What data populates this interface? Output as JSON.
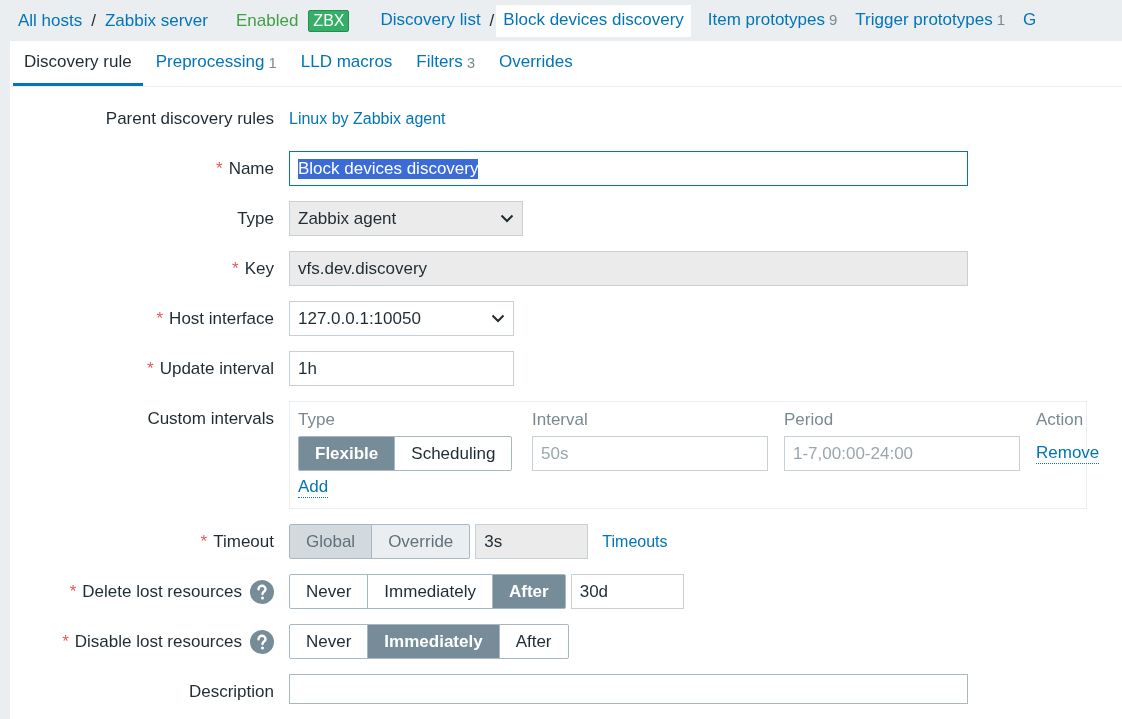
{
  "required_mark": "*",
  "header": {
    "host_path": [
      "All hosts",
      "Zabbix server"
    ],
    "separator": "/",
    "status": "Enabled",
    "badge": "ZBX",
    "discovery_path": [
      {
        "label": "Discovery list",
        "selected": false
      },
      {
        "label": "Block devices discovery",
        "selected": true
      }
    ],
    "nav": [
      {
        "label": "Item prototypes",
        "count": "9"
      },
      {
        "label": "Trigger prototypes",
        "count": "1"
      },
      {
        "label": "G"
      }
    ]
  },
  "tabs": [
    {
      "label": "Discovery rule",
      "selected": true
    },
    {
      "label": "Preprocessing",
      "count": "1",
      "selected": false
    },
    {
      "label": "LLD macros",
      "selected": false
    },
    {
      "label": "Filters",
      "count": "3",
      "selected": false
    },
    {
      "label": "Overrides",
      "selected": false
    }
  ],
  "form": [
    {
      "kind": "link",
      "label": "Parent discovery rules",
      "value": "Linux by Zabbix agent"
    },
    {
      "kind": "text",
      "label": "Name",
      "required": true,
      "value": "Block devices discovery",
      "highlighted": true
    },
    {
      "kind": "select",
      "label": "Type",
      "value": "Zabbix agent"
    },
    {
      "kind": "readonly",
      "label": "Key",
      "required": true,
      "value": "vfs.dev.discovery"
    },
    {
      "kind": "select",
      "label": "Host interface",
      "required": true,
      "value": "127.0.0.1:10050"
    },
    {
      "kind": "text",
      "label": "Update interval",
      "required": true,
      "value": "1h"
    },
    {
      "kind": "intervals",
      "label": "Custom intervals",
      "columns": [
        "Type",
        "Interval",
        "Period",
        "Action"
      ],
      "rows": [
        {
          "options": [
            {
              "label": "Flexible",
              "selected": true
            },
            {
              "label": "Scheduling",
              "selected": false
            }
          ],
          "interval_placeholder": "50s",
          "period_placeholder": "1-7,00:00-24:00",
          "action": "Remove"
        }
      ],
      "add": "Add"
    },
    {
      "kind": "timeout",
      "label": "Timeout",
      "required": true,
      "options": [
        {
          "label": "Global",
          "selected": true
        },
        {
          "label": "Override",
          "selected": false
        }
      ],
      "disabled": true,
      "value": "3s",
      "link": "Timeouts"
    },
    {
      "kind": "segmented",
      "label": "Delete lost resources",
      "required": true,
      "help": true,
      "options": [
        {
          "label": "Never",
          "selected": false
        },
        {
          "label": "Immediately",
          "selected": false
        },
        {
          "label": "After",
          "selected": true
        }
      ],
      "value": "30d"
    },
    {
      "kind": "segmented",
      "label": "Disable lost resources",
      "required": true,
      "help": true,
      "options": [
        {
          "label": "Never",
          "selected": false
        },
        {
          "label": "Immediately",
          "selected": true
        },
        {
          "label": "After",
          "selected": false
        }
      ]
    },
    {
      "kind": "textarea",
      "label": "Description"
    }
  ]
}
